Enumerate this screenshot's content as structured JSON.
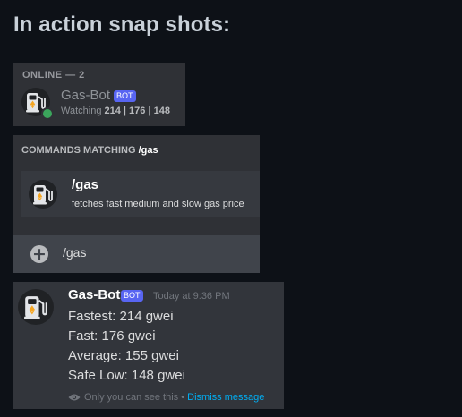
{
  "heading": "In action snap shots:",
  "member_list": {
    "header": "ONLINE — 2",
    "name": "Gas-Bot",
    "bot_tag": "BOT",
    "status_prefix": "Watching",
    "status_values": "214 | 176 | 148",
    "status_color": "#3ba55c"
  },
  "commands": {
    "header_prefix": "COMMANDS MATCHING",
    "header_query": "/gas",
    "item_name": "/gas",
    "item_description": "fetches fast medium and slow gas price",
    "input_value": "/gas"
  },
  "message": {
    "author": "Gas-Bot",
    "bot_tag": "BOT",
    "timestamp": "Today at 9:36 PM",
    "lines": [
      "Fastest: 214 gwei",
      "Fast: 176 gwei",
      "Average: 155 gwei",
      "Safe Low: 148 gwei"
    ],
    "ephemeral_note": "Only you can see this •",
    "dismiss_label": "Dismiss message"
  },
  "icons": [
    "gas-pump-icon",
    "plus-icon",
    "eye-icon",
    "ethereum-icon"
  ],
  "colors": {
    "accent": "#5865f2",
    "link": "#00aff4",
    "eth": "#f5a623"
  }
}
